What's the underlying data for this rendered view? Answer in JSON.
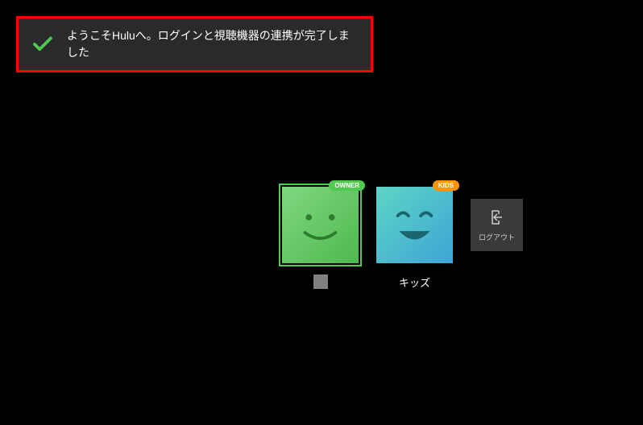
{
  "toast": {
    "message": "ようこそHuluへ。ログインと視聴機器の連携が完了しました",
    "check_color": "#4fc94f"
  },
  "profiles": [
    {
      "badge_text": "OWNER",
      "badge_type": "owner",
      "label": "",
      "label_redacted": true,
      "selected": true,
      "avatar_bg_from": "#7fd87f",
      "avatar_bg_to": "#4fb84f",
      "face_color": "#2d7d2d"
    },
    {
      "badge_text": "KIDS",
      "badge_type": "kids",
      "label": "キッズ",
      "label_redacted": false,
      "selected": false,
      "avatar_bg_from": "#5dd5c5",
      "avatar_bg_to": "#3da5d5",
      "face_color": "#1a6570"
    }
  ],
  "logout": {
    "label": "ログアウト"
  }
}
